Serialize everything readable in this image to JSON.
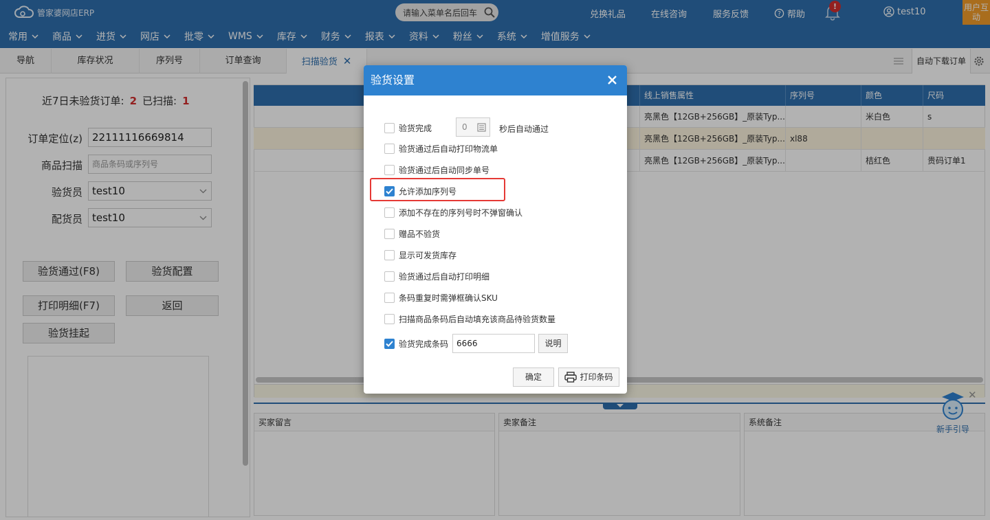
{
  "topbar": {
    "logo_text": "管家婆网店ERP",
    "search_placeholder": "请输入菜单名后回车",
    "links": [
      "兑换礼品",
      "在线咨询",
      "服务反馈"
    ],
    "help": "帮助",
    "bell_badge": "!",
    "user": "test10",
    "side_button": "用户互动"
  },
  "menu": [
    "常用",
    "商品",
    "进货",
    "网店",
    "批零",
    "WMS",
    "库存",
    "财务",
    "报表",
    "资料",
    "粉丝",
    "系统",
    "增值服务"
  ],
  "tabs": {
    "items": [
      "导航",
      "库存状况",
      "序列号",
      "订单查询",
      "扫描验货"
    ],
    "active_index": 4,
    "auto_download": "自动下载订单"
  },
  "left": {
    "summary_label1": "近7日未验货订单:",
    "summary_value1": "2",
    "summary_label2": "已扫描:",
    "summary_value2": "1",
    "order_label": "订单定位(z)",
    "order_value": "22111116669814",
    "scan_label": "商品扫描",
    "scan_placeholder": "商品条码或序列号",
    "inspector_label": "验货员",
    "inspector_value": "test10",
    "packer_label": "配货员",
    "packer_value": "test10",
    "btn_pass": "验货通过(F8)",
    "btn_config": "验货配置",
    "btn_print": "打印明细(F7)",
    "btn_back": "返回",
    "btn_hold": "验货挂起"
  },
  "grid": {
    "headers": [
      "线上销售属性",
      "序列号",
      "颜色",
      "尺码"
    ],
    "rows": [
      {
        "attr": "亮黑色【12GB+256GB】_原装Typ...",
        "serial": "",
        "color": "米白色",
        "size": "s"
      },
      {
        "attr": "亮黑色【12GB+256GB】_原装Typ...",
        "serial": "xl88",
        "color": "",
        "size": ""
      },
      {
        "attr": "亮黑色【12GB+256GB】_原装Typ...",
        "serial": "",
        "color": "桔红色",
        "size": "贵码订单1"
      }
    ]
  },
  "notes": {
    "buyer": "买家留言",
    "seller": "卖家备注",
    "system": "系统备注"
  },
  "guide": "新手引导",
  "modal": {
    "title": "验货设置",
    "opt_complete_prefix": "验货完成",
    "opt_complete_seconds": "0",
    "opt_complete_suffix": "秒后自动通过",
    "options": [
      {
        "label": "验货通过后自动打印物流单",
        "checked": false
      },
      {
        "label": "验货通过后自动同步单号",
        "checked": false
      },
      {
        "label": "允许添加序列号",
        "checked": true
      },
      {
        "label": "添加不存在的序列号时不弹窗确认",
        "checked": false
      },
      {
        "label": "赠品不验货",
        "checked": false
      },
      {
        "label": "显示可发货库存",
        "checked": false
      },
      {
        "label": "验货通过后自动打印明细",
        "checked": false
      },
      {
        "label": "条码重复时需弹框确认SKU",
        "checked": false
      },
      {
        "label": "扫描商品条码后自动填充该商品待验货数量",
        "checked": false
      }
    ],
    "code_label": "验货完成条码",
    "code_value": "6666",
    "explain": "说明",
    "ok": "确定",
    "print_code": "打印条码"
  },
  "colors": {
    "brand_blue": "#2e6fae",
    "modal_blue": "#2e82d0",
    "count_red": "#d32f2f",
    "highlight_red": "#e53935"
  }
}
